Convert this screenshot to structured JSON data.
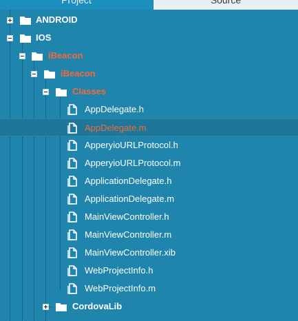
{
  "tabs": {
    "project_label": "Project",
    "source_label": "Source"
  },
  "tree": {
    "android": "ANDROID",
    "ios": "IOS",
    "ibeacon_group": "iBeacon",
    "ibeacon_project": "iBeacon",
    "classes": "Classes",
    "files": [
      "AppDelegate.h",
      "AppDelegate.m",
      "ApperyioURLProtocol.h",
      "ApperyioURLProtocol.m",
      "ApplicationDelegate.h",
      "ApplicationDelegate.m",
      "MainViewController.h",
      "MainViewController.m",
      "MainViewController.xib",
      "WebProjectInfo.h",
      "WebProjectInfo.m"
    ],
    "cordovalib": "CordovaLib",
    "selected_file": "AppDelegate.m"
  },
  "colors": {
    "background": "#2085ad",
    "highlight": "#f26a3d",
    "selected_row": "#1e7799"
  }
}
